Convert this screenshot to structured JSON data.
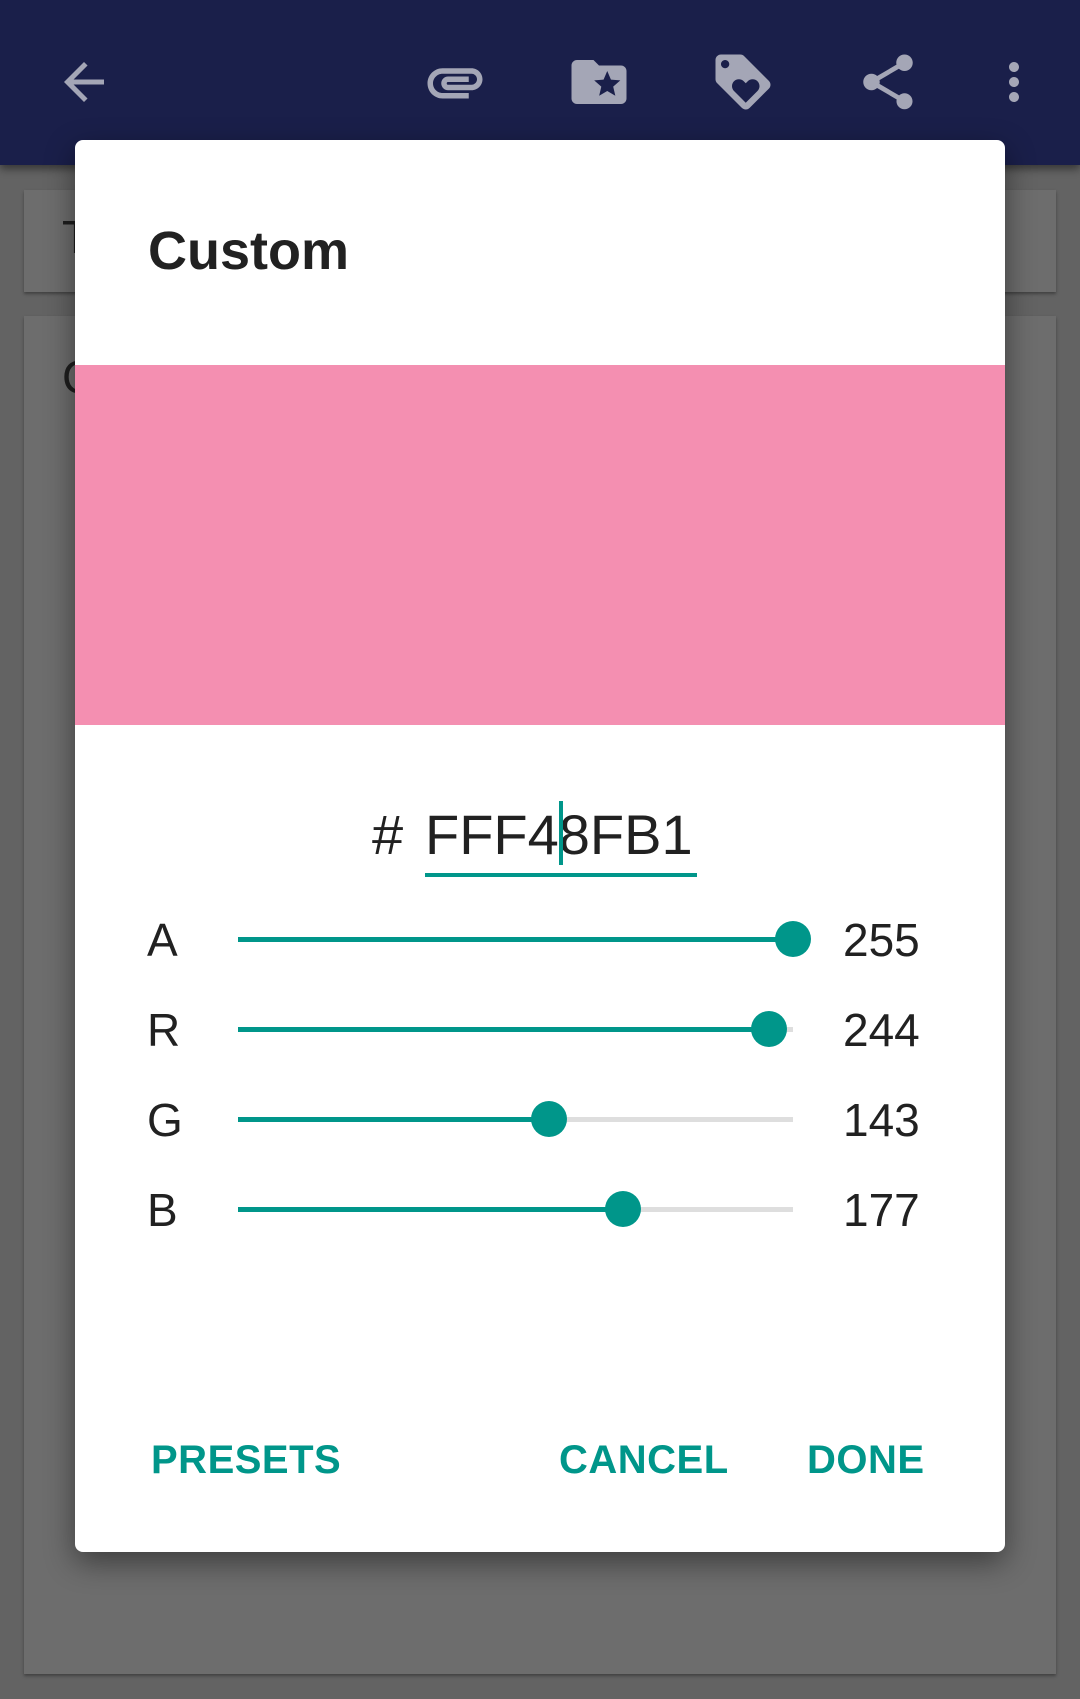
{
  "appbar": {
    "background": "#1a1f4a",
    "icon_color": "#a4a6b6",
    "icons": [
      "back-arrow-icon",
      "attachment-icon",
      "folder-star-icon",
      "tag-heart-icon",
      "share-icon",
      "more-vert-icon"
    ]
  },
  "background_content": {
    "card1_glyph": "T",
    "card2_glyph": "C"
  },
  "dialog": {
    "title": "Custom",
    "swatch_color": "#F48FB1",
    "hex": {
      "prefix": "#",
      "value": "FFF48FB1"
    },
    "sliders": [
      {
        "label": "A",
        "value": "255",
        "fraction": 1.0
      },
      {
        "label": "R",
        "value": "244",
        "fraction": 0.957
      },
      {
        "label": "G",
        "value": "143",
        "fraction": 0.561
      },
      {
        "label": "B",
        "value": "177",
        "fraction": 0.694
      }
    ],
    "buttons": {
      "presets": "PRESETS",
      "cancel": "CANCEL",
      "done": "DONE"
    },
    "accent_color": "#00968A"
  }
}
